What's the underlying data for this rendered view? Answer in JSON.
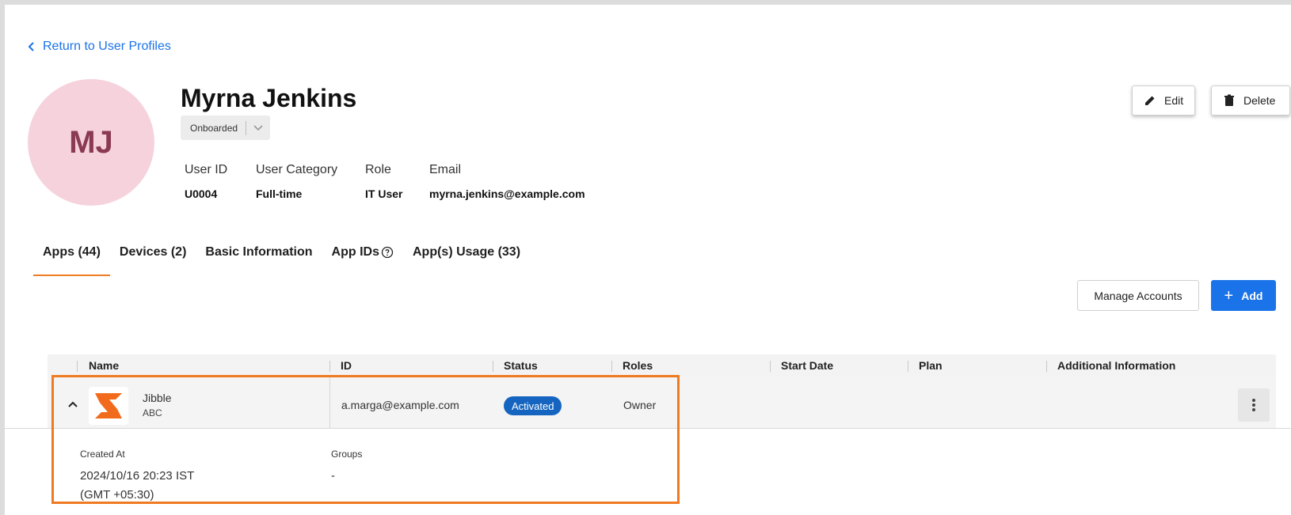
{
  "nav": {
    "back_label": "Return to User Profiles"
  },
  "user": {
    "initials": "MJ",
    "name": "Myrna Jenkins",
    "status": "Onboarded",
    "fields": {
      "user_id_label": "User ID",
      "user_id": "U0004",
      "category_label": "User Category",
      "category": "Full-time",
      "role_label": "Role",
      "role": "IT User",
      "email_label": "Email",
      "email": "myrna.jenkins@example.com"
    }
  },
  "actions": {
    "edit_label": "Edit",
    "delete_label": "Delete"
  },
  "tabs": [
    {
      "label": "Apps (44)"
    },
    {
      "label": "Devices (2)"
    },
    {
      "label": "Basic Information"
    },
    {
      "label": "App IDs"
    },
    {
      "label": "App(s) Usage (33)"
    }
  ],
  "toolbar": {
    "manage_label": "Manage Accounts",
    "add_label": "Add"
  },
  "table": {
    "columns": [
      "Name",
      "ID",
      "Status",
      "Roles",
      "Start Date",
      "Plan",
      "Additional Information"
    ],
    "rows": [
      {
        "app_name": "Jibble",
        "app_sub": "ABC",
        "id": "a.marga@example.com",
        "status": "Activated",
        "roles": "Owner",
        "start_date": "",
        "plan": "",
        "additional": ""
      }
    ],
    "detail": {
      "created_label": "Created At",
      "created_line1": "2024/10/16 20:23 IST",
      "created_line2": "(GMT +05:30)",
      "groups_label": "Groups",
      "groups_value": "-"
    }
  },
  "colors": {
    "accent": "#f07a22",
    "primary": "#1a73e8",
    "badge": "#1565c0",
    "avatar_bg": "#f5d2dc",
    "avatar_text": "#8a3a52"
  },
  "icons": {
    "back": "chevron-left-icon",
    "edit": "pencil-icon",
    "delete": "trash-icon",
    "help": "help-circle-icon",
    "add": "plus-icon",
    "expand": "chevron-up-icon",
    "more": "kebab-menu-icon"
  }
}
